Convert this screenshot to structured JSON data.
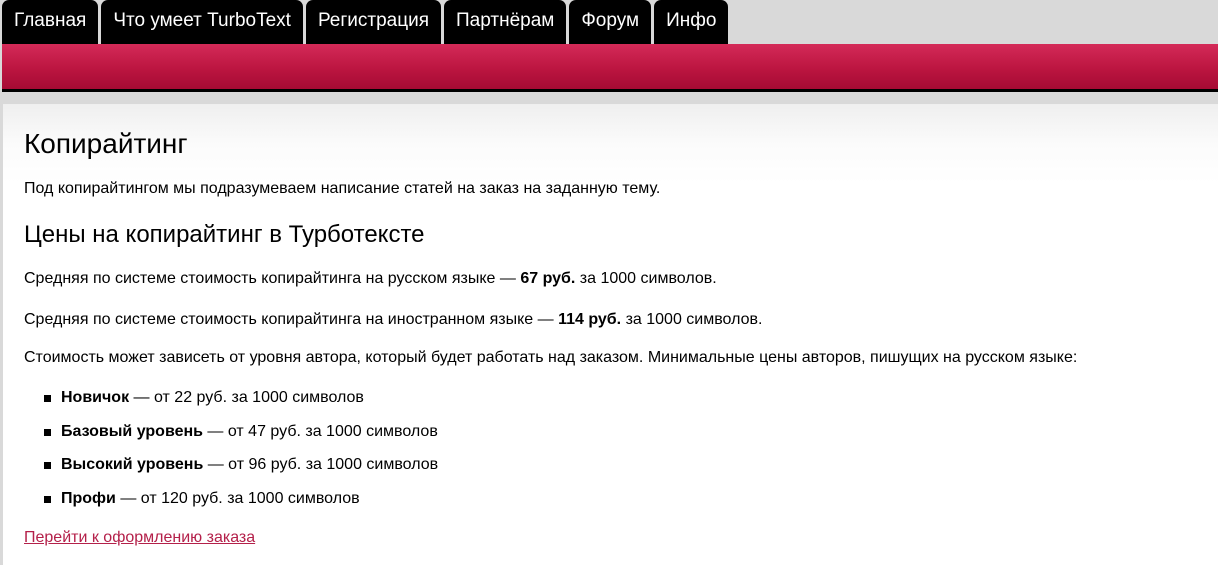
{
  "nav": {
    "tabs": [
      {
        "label": "Главная"
      },
      {
        "label": "Что умеет TurboText"
      },
      {
        "label": "Регистрация"
      },
      {
        "label": "Партнёрам"
      },
      {
        "label": "Форум"
      },
      {
        "label": "Инфо"
      }
    ]
  },
  "colors": {
    "brand_band": "#bb1540",
    "link": "#b4204a"
  },
  "main": {
    "title": "Копирайтинг",
    "intro": "Под копирайтингом мы подразумеваем написание статей на заказ на заданную тему.",
    "prices_heading": "Цены на копирайтинг в Турботексте",
    "avg_ru": {
      "prefix": "Средняя по системе стоимость копирайтинга на русском языке — ",
      "price": "67 руб.",
      "suffix": " за 1000 символов."
    },
    "avg_foreign": {
      "prefix": "Средняя по системе стоимость копирайтинга на иностранном языке — ",
      "price": "114 руб.",
      "suffix": " за 1000 символов."
    },
    "levels_intro": "Стоимость может зависеть от уровня автора, который будет работать над заказом. Минимальные цены авторов, пишущих на русском языке:",
    "levels": [
      {
        "name": "Новичок",
        "price": " — от 22 руб. за 1000 символов"
      },
      {
        "name": "Базовый уровень",
        "price": " — от 47 руб. за 1000 символов"
      },
      {
        "name": "Высокий уровень",
        "price": " — от 96 руб. за 1000 символов"
      },
      {
        "name": "Профи",
        "price": " — от 120 руб. за 1000 символов"
      }
    ],
    "order_link": "Перейти к оформлению заказа"
  }
}
